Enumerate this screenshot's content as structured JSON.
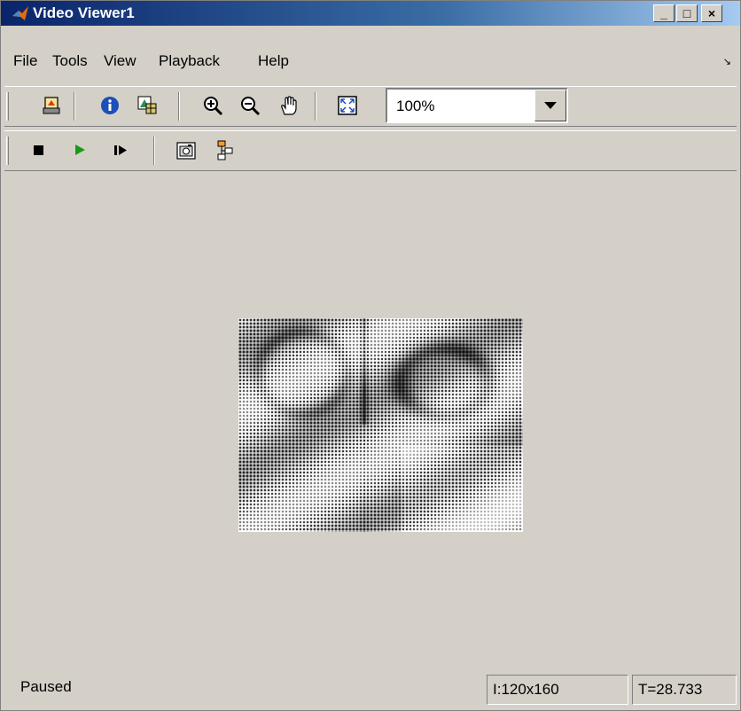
{
  "window": {
    "title": "Video Viewer1"
  },
  "window_controls": {
    "minimize": "_",
    "maximize": "□",
    "close": "×"
  },
  "menu": [
    "File",
    "Tools",
    "View",
    "Playback",
    "Help"
  ],
  "toolbar": {
    "zoom_value": "100%",
    "icons": [
      "print-icon",
      "info-icon",
      "colormap-icon",
      "zoom-in-icon",
      "zoom-out-icon",
      "pan-hand-icon",
      "fit-to-view-icon"
    ]
  },
  "playback_toolbar": {
    "icons": [
      "stop-icon",
      "play-icon",
      "step-forward-icon",
      "snapshot-icon",
      "highlight-simulink-icon"
    ]
  },
  "colors": {
    "title_start": "#0a246a",
    "title_end": "#a6caf0",
    "background": "#d4d0c8",
    "play_green": "#1a9a1a"
  },
  "status": {
    "state": "Paused",
    "image_size": "I:120x160",
    "time": "T=28.733"
  }
}
